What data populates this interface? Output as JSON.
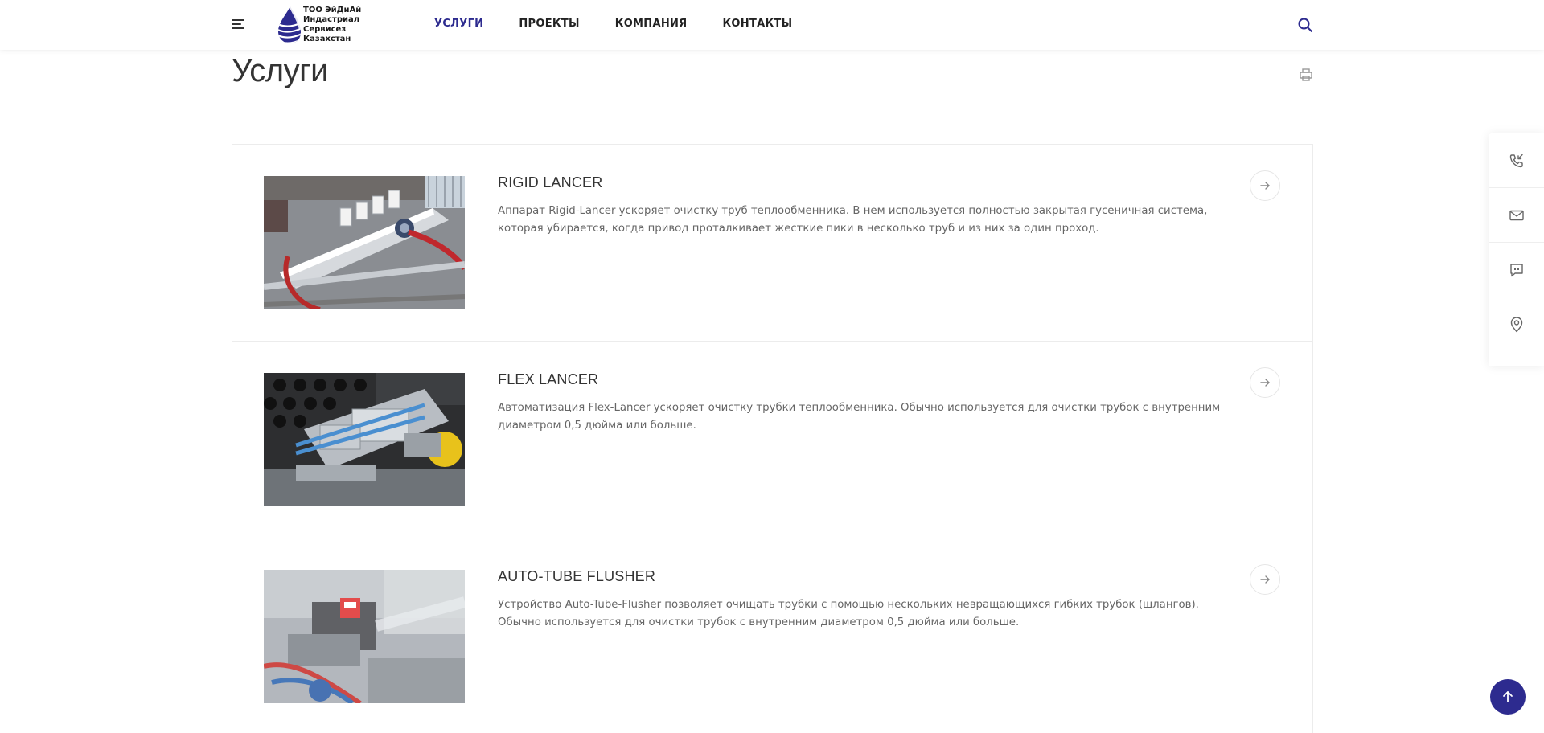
{
  "header": {
    "logo_text": "ТОО ЭйДиАй\nИндастриал\nСервисез\nКазахстан",
    "nav": [
      {
        "label": "УСЛУГИ",
        "active": true
      },
      {
        "label": "ПРОЕКТЫ",
        "active": false
      },
      {
        "label": "КОМПАНИЯ",
        "active": false
      },
      {
        "label": "КОНТАКТЫ",
        "active": false
      }
    ]
  },
  "page": {
    "title": "Услуги"
  },
  "services": [
    {
      "title": "RIGID LANCER",
      "description": "Аппарат Rigid-Lancer ускоряет очистку труб теплообменника. В нем используется полностью закрытая гусеничная система, которая убирается, когда привод проталкивает жесткие пики в несколько труб и из них за один проход."
    },
    {
      "title": "FLEX LANCER",
      "description": "Автоматизация Flex-Lancer ускоряет очистку трубки теплообменника. Обычно используется для очистки трубок с внутренним диаметром 0,5 дюйма или больше."
    },
    {
      "title": "AUTO-TUBE FLUSHER",
      "description": "Устройство Auto-Tube-Flusher позволяет очищать трубки с помощью нескольких невращающихся гибких трубок (шлангов). Обычно используется для очистки трубок с внутренним диаметром 0,5 дюйма или больше."
    }
  ],
  "side_bar": {
    "icons": [
      "phone-callback-icon",
      "mail-icon",
      "chat-icon",
      "location-pin-icon"
    ]
  },
  "colors": {
    "accent": "#2d2b8f",
    "text": "#333333",
    "muted": "#666666",
    "border": "#ececec"
  }
}
